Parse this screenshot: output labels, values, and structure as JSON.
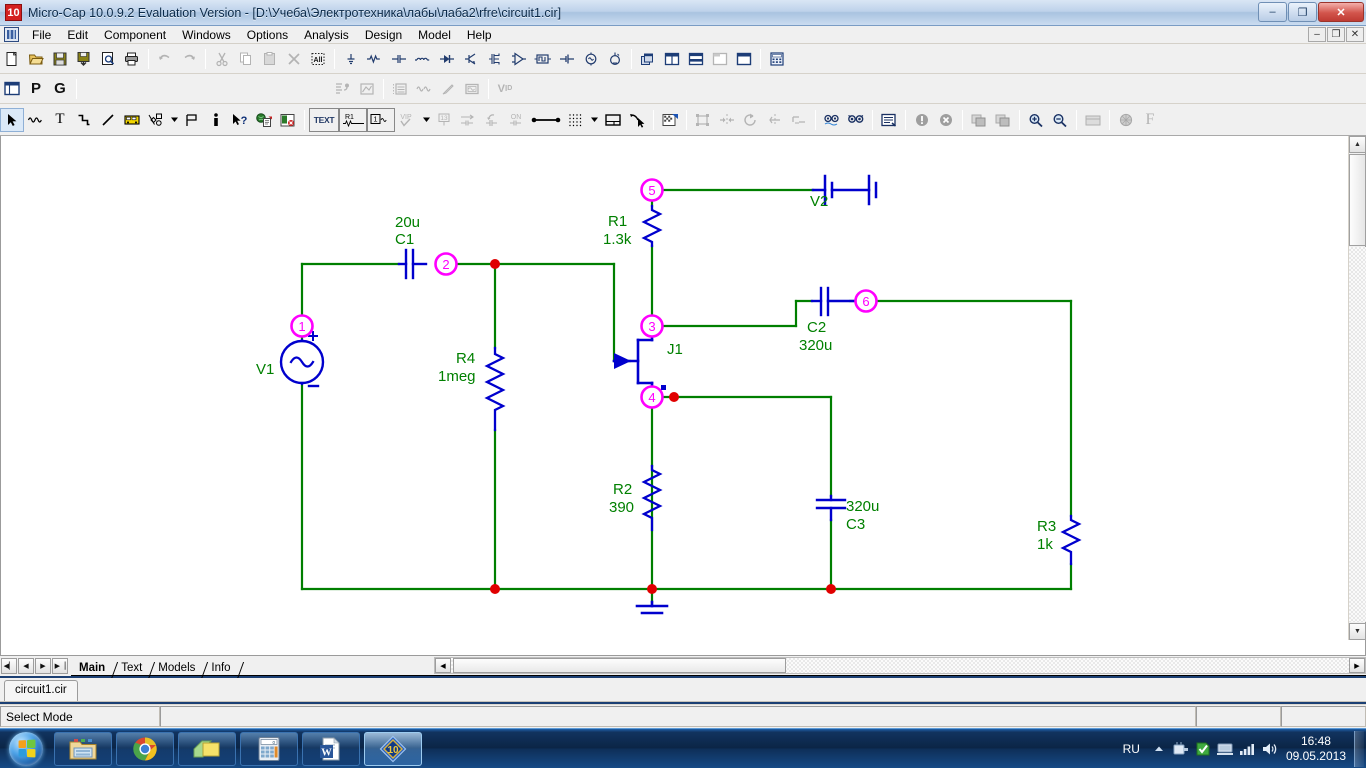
{
  "window": {
    "title": "Micro-Cap 10.0.9.2 Evaluation Version - [D:\\Учеба\\Электротехника\\лабы\\лаба2\\rfre\\circuit1.cir]",
    "app_icon_label": "10",
    "controls": {
      "minimize": "–",
      "maximize": "❐",
      "close": "✕"
    },
    "mdi_controls": {
      "minimize": "–",
      "restore": "❐",
      "close": "✕"
    }
  },
  "menu": {
    "items": [
      "File",
      "Edit",
      "Component",
      "Windows",
      "Options",
      "Analysis",
      "Design",
      "Model",
      "Help"
    ]
  },
  "toolbar_row1": [
    {
      "name": "new-file-icon",
      "label": "New",
      "disabled": false
    },
    {
      "name": "open-file-icon",
      "label": "Open",
      "disabled": false
    },
    {
      "name": "save-icon",
      "label": "Save",
      "disabled": false
    },
    {
      "name": "save-all-icon",
      "label": "Save All",
      "disabled": false
    },
    {
      "name": "print-preview-icon",
      "label": "Print Preview",
      "disabled": false
    },
    {
      "name": "print-icon",
      "label": "Print",
      "disabled": false
    },
    {
      "name": "undo-icon",
      "label": "Undo",
      "disabled": true
    },
    {
      "name": "redo-icon",
      "label": "Redo",
      "disabled": true
    },
    {
      "name": "cut-icon",
      "label": "Cut",
      "disabled": true
    },
    {
      "name": "copy-icon",
      "label": "Copy",
      "disabled": true
    },
    {
      "name": "paste-icon",
      "label": "Paste",
      "disabled": true
    },
    {
      "name": "delete-icon",
      "label": "Clear",
      "disabled": true
    },
    {
      "name": "select-all-icon",
      "label": "Select All",
      "disabled": false
    },
    {
      "name": "ground-icon",
      "label": "Ground",
      "disabled": false
    },
    {
      "name": "resistor-icon",
      "label": "Resistor",
      "disabled": false
    },
    {
      "name": "capacitor-icon",
      "label": "Capacitor",
      "disabled": false
    },
    {
      "name": "inductor-icon",
      "label": "Inductor",
      "disabled": false
    },
    {
      "name": "diode-icon",
      "label": "Diode",
      "disabled": false
    },
    {
      "name": "npn-transistor-icon",
      "label": "NPN",
      "disabled": false
    },
    {
      "name": "mosfet-icon",
      "label": "MOSFET",
      "disabled": false
    },
    {
      "name": "opamp-icon",
      "label": "Opamp",
      "disabled": false
    },
    {
      "name": "pulse-source-icon",
      "label": "Pulse Source",
      "disabled": false
    },
    {
      "name": "battery-icon",
      "label": "Battery",
      "disabled": false
    },
    {
      "name": "sine-source-icon",
      "label": "Sine Source",
      "disabled": false
    },
    {
      "name": "dependent-source-icon",
      "label": "Dependent Source",
      "disabled": false
    },
    {
      "name": "tile-windows-icon",
      "label": "Cascade",
      "disabled": false
    },
    {
      "name": "tile-vertical-icon",
      "label": "Tile Vertical",
      "disabled": false
    },
    {
      "name": "tile-horizontal-icon",
      "label": "Tile Horizontal",
      "disabled": false
    },
    {
      "name": "overlap-windows-icon",
      "label": "Overlap",
      "disabled": true
    },
    {
      "name": "maximize-window-icon",
      "label": "Maximize",
      "disabled": false
    },
    {
      "name": "calculator-icon",
      "label": "Calculator",
      "disabled": false
    }
  ],
  "toolbar_row2": {
    "left": [
      {
        "name": "window-panel-icon",
        "label": "Window"
      },
      {
        "name": "probe-p-icon",
        "label": "P"
      },
      {
        "name": "probe-g-icon",
        "label": "G"
      }
    ],
    "right": [
      {
        "name": "step-into-icon",
        "label": "Step",
        "disabled": true
      },
      {
        "name": "plot-window-icon",
        "label": "Plot",
        "disabled": true
      },
      {
        "name": "numeric-output-icon",
        "label": "Numeric Output",
        "disabled": true
      },
      {
        "name": "waveform-icon",
        "label": "Waveforms",
        "disabled": true
      },
      {
        "name": "probe-pen-icon",
        "label": "Probe",
        "disabled": true
      },
      {
        "name": "scope-icon",
        "label": "Scope",
        "disabled": true
      },
      {
        "name": "vid-icon",
        "label": "V I D",
        "disabled": true
      }
    ]
  },
  "toolbar_row3": [
    {
      "name": "select-arrow-icon",
      "label": "Select Mode",
      "active": true,
      "disabled": false
    },
    {
      "name": "component-mode-icon",
      "label": "Component Mode",
      "disabled": false
    },
    {
      "name": "text-mode-icon",
      "label": "Text Mode",
      "disabled": false
    },
    {
      "name": "wire-mode-icon",
      "label": "Wire Mode",
      "disabled": false
    },
    {
      "name": "diagonal-wire-icon",
      "label": "Diagonal Wire",
      "disabled": false
    },
    {
      "name": "bus-mode-icon",
      "label": "Bus",
      "disabled": false
    },
    {
      "name": "graphic-objects-icon",
      "label": "Graphic Objects",
      "disabled": false
    },
    {
      "name": "dropdown-shapes-icon",
      "label": "Shapes",
      "disabled": false
    },
    {
      "name": "flag-mode-icon",
      "label": "Flag",
      "disabled": false
    },
    {
      "name": "info-mode-icon",
      "label": "Info",
      "disabled": false
    },
    {
      "name": "help-pointer-icon",
      "label": "Help Mode",
      "disabled": false
    },
    {
      "name": "region-enable-icon",
      "label": "Region Enable",
      "disabled": false
    },
    {
      "name": "disable-icon",
      "label": "Disable",
      "disabled": false
    },
    {
      "name": "text-attribute-icon",
      "label": "TEXT",
      "disabled": false
    },
    {
      "name": "part-attribute-icon",
      "label": "R1",
      "disabled": false
    },
    {
      "name": "node-number-icon",
      "label": "Node Numbers",
      "disabled": false
    },
    {
      "name": "vip-icon",
      "label": "VIP",
      "disabled": true
    },
    {
      "name": "dropdown-arrow-icon",
      "label": "More",
      "disabled": false
    },
    {
      "name": "grid-text-icon",
      "label": "Grid Text",
      "disabled": true
    },
    {
      "name": "node-voltage-icon",
      "label": "Node Voltages",
      "disabled": true
    },
    {
      "name": "current-arrow-icon",
      "label": "Currents",
      "disabled": true
    },
    {
      "name": "power-on-icon",
      "label": "Power",
      "disabled": true
    },
    {
      "name": "connect-icon",
      "label": "Connect",
      "disabled": false
    },
    {
      "name": "grid-dots-icon",
      "label": "Grid",
      "disabled": false
    },
    {
      "name": "grid-dropdown-icon",
      "label": "Grid Options",
      "disabled": false
    },
    {
      "name": "title-block-icon",
      "label": "Title Block",
      "disabled": false
    },
    {
      "name": "cursor-pick-icon",
      "label": "Pick",
      "disabled": false
    },
    {
      "name": "properties-icon",
      "label": "Properties",
      "disabled": false
    },
    {
      "name": "group-icon",
      "label": "Group",
      "disabled": true
    },
    {
      "name": "mirror-icon",
      "label": "Mirror",
      "disabled": true
    },
    {
      "name": "rotate-icon",
      "label": "Rotate",
      "disabled": true
    },
    {
      "name": "flip-icon",
      "label": "Flip",
      "disabled": true
    },
    {
      "name": "step-bias-icon",
      "label": "Step Bias",
      "disabled": true
    },
    {
      "name": "find-icon",
      "label": "Find",
      "disabled": false
    },
    {
      "name": "find-component-icon",
      "label": "Find Component",
      "disabled": false
    },
    {
      "name": "model-editor-icon",
      "label": "Model Editor",
      "disabled": false
    },
    {
      "name": "error-icon",
      "label": "Error",
      "disabled": true
    },
    {
      "name": "cancel-icon",
      "label": "Cancel",
      "disabled": true
    },
    {
      "name": "copy-region-icon",
      "label": "Copy Region",
      "disabled": true
    },
    {
      "name": "paste-region-icon",
      "label": "Paste Region",
      "disabled": true
    },
    {
      "name": "zoom-in-icon",
      "label": "Zoom In",
      "disabled": false
    },
    {
      "name": "zoom-out-icon",
      "label": "Zoom Out",
      "disabled": false
    },
    {
      "name": "palette-icon",
      "label": "Palette",
      "disabled": true
    },
    {
      "name": "color-wheel-icon",
      "label": "Colors",
      "disabled": true
    },
    {
      "name": "font-icon",
      "label": "F",
      "disabled": true
    }
  ],
  "schematic": {
    "colors": {
      "wire": "#007f00",
      "component": "#0000cd",
      "label": "#008000",
      "node_circle": "#ff00ff",
      "junction_dot": "#e00000",
      "background": "#ffffff"
    },
    "node_numbers": [
      "1",
      "2",
      "3",
      "4",
      "5",
      "6"
    ],
    "components": [
      {
        "ref": "V1",
        "type": "sine-source",
        "value": "",
        "plus": "+",
        "minus": "–"
      },
      {
        "ref": "C1",
        "type": "capacitor",
        "value": "20u"
      },
      {
        "ref": "R4",
        "type": "resistor",
        "value": "1meg"
      },
      {
        "ref": "R1",
        "type": "resistor",
        "value": "1.3k"
      },
      {
        "ref": "V2",
        "type": "battery",
        "value": ""
      },
      {
        "ref": "J1",
        "type": "jfet",
        "value": ""
      },
      {
        "ref": "C2",
        "type": "capacitor",
        "value": "320u"
      },
      {
        "ref": "R3",
        "type": "resistor",
        "value": "1k"
      },
      {
        "ref": "R2",
        "type": "resistor",
        "value": "390"
      },
      {
        "ref": "C3",
        "type": "capacitor",
        "value": "320u"
      },
      {
        "ref": "GND",
        "type": "ground",
        "value": ""
      }
    ]
  },
  "tabstrip": {
    "nav": [
      "◀▏",
      "◀",
      "▶",
      "▶▕"
    ],
    "tabs": [
      {
        "label": "Main",
        "active": true
      },
      {
        "label": "Text",
        "active": false
      },
      {
        "label": "Models",
        "active": false
      },
      {
        "label": "Info",
        "active": false
      }
    ]
  },
  "file_tabs": [
    {
      "label": "circuit1.cir",
      "active": true
    }
  ],
  "statusbar": {
    "mode": "Select Mode",
    "middle": "",
    "slot1": "",
    "slot2": ""
  },
  "taskbar": {
    "start_label": "Start",
    "items": [
      {
        "name": "explorer",
        "label": "Windows Explorer",
        "active": false
      },
      {
        "name": "chrome",
        "label": "Google Chrome",
        "active": false
      },
      {
        "name": "sticky-notes",
        "label": "Sticky Notes",
        "active": false
      },
      {
        "name": "calculator",
        "label": "Calculator",
        "active": false
      },
      {
        "name": "word",
        "label": "Microsoft Word",
        "active": false
      },
      {
        "name": "microcap",
        "label": "Micro-Cap 10",
        "active": true
      }
    ],
    "tray": {
      "language": "RU",
      "icons": [
        "show-hidden-icons",
        "safely-remove-hardware",
        "antivirus",
        "network",
        "signal",
        "volume"
      ],
      "time": "16:48",
      "date": "09.05.2013"
    }
  }
}
